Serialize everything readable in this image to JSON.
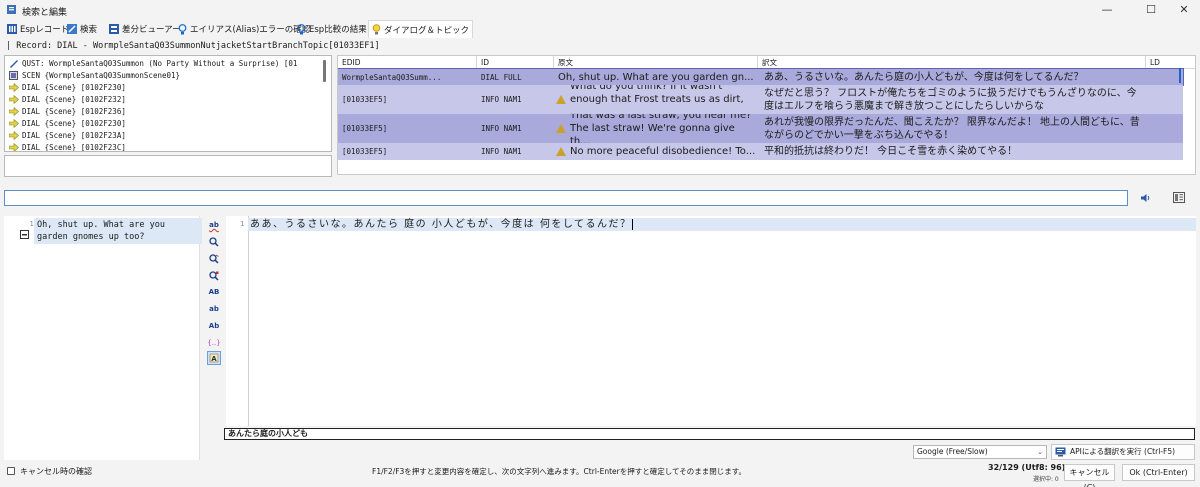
{
  "window": {
    "title": "検索と編集"
  },
  "tabs": [
    {
      "label": "Espレコード"
    },
    {
      "label": "検索"
    },
    {
      "label": "差分ビューアー"
    },
    {
      "label": "エイリアス(Alias)エラーの確認"
    },
    {
      "label": "Esp比較の結果"
    },
    {
      "label": "ダイアログ＆トピック"
    }
  ],
  "record_line": "| Record: DIAL - WormpleSantaQ03SummonNutjacketStartBranchTopic[01033EF1]",
  "tree": {
    "items": [
      {
        "label": "QUST: WormpleSantaQ03Summon (No Party Without a Surprise) [01"
      },
      {
        "label": "SCEN {WormpleSantaQ03SummonScene01}"
      },
      {
        "label": "DIAL {Scene} [0102F230]"
      },
      {
        "label": "DIAL {Scene} [0102F232]"
      },
      {
        "label": "DIAL {Scene} [0102F236]"
      },
      {
        "label": "DIAL {Scene} [0102F230]"
      },
      {
        "label": "DIAL {Scene} [0102F23A]"
      },
      {
        "label": "DIAL {Scene} [0102F23C]"
      }
    ]
  },
  "grid": {
    "columns": [
      "EDID",
      "ID",
      "原文",
      "訳文",
      "LD"
    ],
    "rows": [
      {
        "edid": "WormpleSantaQ03Summ...",
        "id": "DIAL FULL",
        "src": "Oh, shut up. What are you garden gn...",
        "dst": "ああ、うるさいな。あんたら庭の小人どもが、今度は何をしてるんだ？",
        "warn": false
      },
      {
        "edid": "[01033EF5]",
        "id": "INFO NAM1",
        "src": "What do you think? If it wasn't enough that Frost treats us as dirt, ...",
        "dst": "なぜだと思う？ フロストが俺たちをゴミのように扱うだけでもうんざりなのに、今度はエルフを喰らう悪魔まで解き放つことにしたらしいからな",
        "warn": true
      },
      {
        "edid": "[01033EF5]",
        "id": "INFO NAM1",
        "src": "That was a last straw, you hear me? The last straw! We're gonna give th...",
        "dst": "あれが我慢の限界だったんだ、聞こえたか？ 限界なんだよ！ 地上の人間どもに、昔ながらのどでかい一撃をぶち込んでやる！",
        "warn": true
      },
      {
        "edid": "[01033EF5]",
        "id": "INFO NAM1",
        "src": "No more peaceful disobedience! To...",
        "dst": "平和的抵抗は終わりだ！ 今日こそ雪を赤く染めてやる！",
        "warn": true
      }
    ]
  },
  "source_text": {
    "line_no": "1",
    "text": "Oh, shut up. What are you garden gnomes up too?"
  },
  "toolbar": {
    "icons": [
      "ab",
      "",
      "",
      "",
      "AB",
      "ab",
      "Ab",
      "{..}",
      ""
    ]
  },
  "editor": {
    "line_no": "1",
    "text": "ああ、うるさいな。あんたら 庭の 小人どもが、今度は 何をしてるんだ？",
    "glossary": "あんたら庭の小人ども"
  },
  "bottom": {
    "engine": "Google (Free/Slow)",
    "api_button": "APIによる翻訳を実行 (Ctrl-F5)",
    "checkbox_label": "キャンセル時の確認",
    "hint": "F1/F2/F3を押すと変更内容を確定し、次の文字列へ進みます。Ctrl-Enterを押すと確定してそのまま閉じます。",
    "counter": "32/129 (Utf8: 96)",
    "selected": "選択中: 0",
    "cancel": "キャンセル(C)",
    "ok": "Ok (Ctrl-Enter)"
  },
  "colors": {
    "selected_row": "#a9a9dc",
    "row": "#c7c7ea",
    "accent": "#1668c6",
    "warning": "#c9a227"
  }
}
